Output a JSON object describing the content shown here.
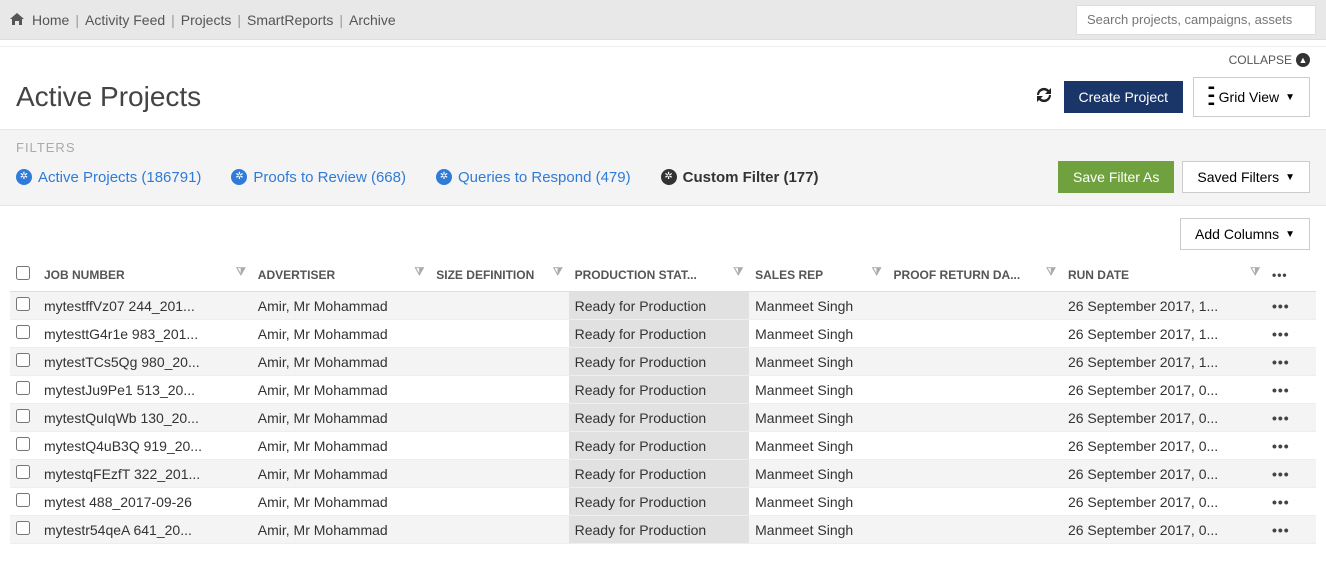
{
  "nav": {
    "home": "Home",
    "feed": "Activity Feed",
    "projects": "Projects",
    "smart": "SmartReports",
    "archive": "Archive"
  },
  "search": {
    "placeholder": "Search projects, campaigns, assets"
  },
  "collapse": "COLLAPSE",
  "page_title": "Active Projects",
  "buttons": {
    "create": "Create Project",
    "grid": "Grid View",
    "save_filter": "Save Filter As",
    "saved_filters": "Saved Filters",
    "add_columns": "Add Columns"
  },
  "filters_label": "FILTERS",
  "filters": {
    "active": "Active Projects (186791)",
    "proofs": "Proofs to Review (668)",
    "queries": "Queries to Respond (479)",
    "custom": "Custom Filter (177)"
  },
  "columns": {
    "job": "JOB NUMBER",
    "adv": "ADVERTISER",
    "size": "SIZE DEFINITION",
    "prod": "PRODUCTION STAT...",
    "sales": "SALES REP",
    "proof": "PROOF RETURN DA...",
    "run": "RUN DATE"
  },
  "rows": [
    {
      "job": "mytestffVz07 244_201...",
      "adv": "Amir, Mr Mohammad",
      "size": "",
      "prod": "Ready for Production",
      "sales": "Manmeet Singh",
      "proof": "",
      "run": "26 September 2017, 1..."
    },
    {
      "job": "mytesttG4r1e 983_201...",
      "adv": "Amir, Mr Mohammad",
      "size": "",
      "prod": "Ready for Production",
      "sales": "Manmeet Singh",
      "proof": "",
      "run": "26 September 2017, 1..."
    },
    {
      "job": "mytestTCs5Qg 980_20...",
      "adv": "Amir, Mr Mohammad",
      "size": "",
      "prod": "Ready for Production",
      "sales": "Manmeet Singh",
      "proof": "",
      "run": "26 September 2017, 1..."
    },
    {
      "job": "mytestJu9Pe1 513_20...",
      "adv": "Amir, Mr Mohammad",
      "size": "",
      "prod": "Ready for Production",
      "sales": "Manmeet Singh",
      "proof": "",
      "run": "26 September 2017, 0..."
    },
    {
      "job": "mytestQuIqWb 130_20...",
      "adv": "Amir, Mr Mohammad",
      "size": "",
      "prod": "Ready for Production",
      "sales": "Manmeet Singh",
      "proof": "",
      "run": "26 September 2017, 0..."
    },
    {
      "job": "mytestQ4uB3Q 919_20...",
      "adv": "Amir, Mr Mohammad",
      "size": "",
      "prod": "Ready for Production",
      "sales": "Manmeet Singh",
      "proof": "",
      "run": "26 September 2017, 0..."
    },
    {
      "job": "mytestqFEzfT 322_201...",
      "adv": "Amir, Mr Mohammad",
      "size": "",
      "prod": "Ready for Production",
      "sales": "Manmeet Singh",
      "proof": "",
      "run": "26 September 2017, 0..."
    },
    {
      "job": "mytest 488_2017-09-26",
      "adv": "Amir, Mr Mohammad",
      "size": "",
      "prod": "Ready for Production",
      "sales": "Manmeet Singh",
      "proof": "",
      "run": "26 September 2017, 0..."
    },
    {
      "job": "mytestr54qeA 641_20...",
      "adv": "Amir, Mr Mohammad",
      "size": "",
      "prod": "Ready for Production",
      "sales": "Manmeet Singh",
      "proof": "",
      "run": "26 September 2017, 0..."
    }
  ]
}
